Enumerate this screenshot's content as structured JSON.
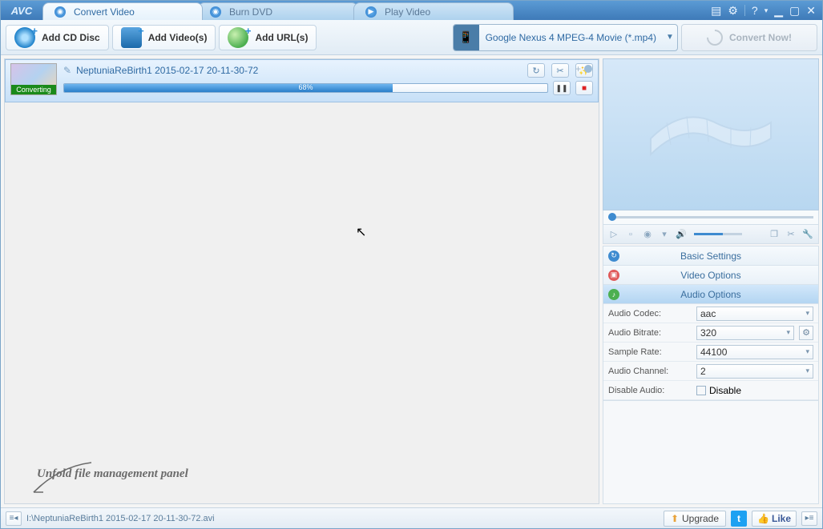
{
  "app_name": "AVC",
  "tabs": {
    "convert": "Convert Video",
    "burn": "Burn DVD",
    "play": "Play Video"
  },
  "toolbar": {
    "add_cd": "Add CD Disc",
    "add_videos": "Add Video(s)",
    "add_urls": "Add URL(s)",
    "profile": "Google Nexus 4 MPEG-4 Movie (*.mp4)",
    "convert_now": "Convert Now!"
  },
  "item": {
    "filename": "NeptuniaReBirth1 2015-02-17 20-11-30-72",
    "badge": "Converting",
    "progress_pct": 68,
    "progress_label": "68%"
  },
  "annotation": "Unfold file management panel",
  "accordion": {
    "basic": "Basic Settings",
    "video": "Video Options",
    "audio": "Audio Options"
  },
  "audio_settings": {
    "codec_label": "Audio Codec:",
    "codec_value": "aac",
    "bitrate_label": "Audio Bitrate:",
    "bitrate_value": "320",
    "samplerate_label": "Sample Rate:",
    "samplerate_value": "44100",
    "channel_label": "Audio Channel:",
    "channel_value": "2",
    "disable_label": "Disable Audio:",
    "disable_value": "Disable"
  },
  "statusbar": {
    "path": "I:\\NeptuniaReBirth1 2015-02-17 20-11-30-72.avi",
    "upgrade": "Upgrade",
    "like": "Like"
  }
}
